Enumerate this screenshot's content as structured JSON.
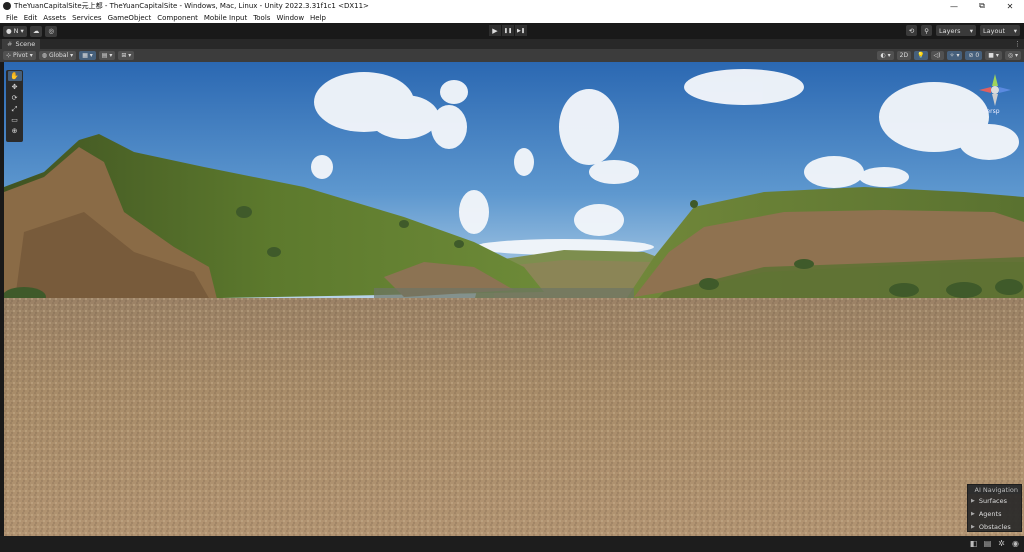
{
  "window": {
    "title": "TheYuanCapitalSite元上都 - TheYuanCapitalSite - Windows, Mac, Linux - Unity 2022.3.31f1c1 <DX11>",
    "controls": {
      "minimize": "—",
      "maximize": "⧉",
      "close": "✕"
    }
  },
  "menu": {
    "items": [
      "File",
      "Edit",
      "Assets",
      "Services",
      "GameObject",
      "Component",
      "Mobile Input",
      "Tools",
      "Window",
      "Help"
    ]
  },
  "toolbar": {
    "account": "N",
    "play": "▶",
    "pause": "❚❚",
    "step": "▶❚",
    "history_icon": "history-icon",
    "search_icon": "search-icon",
    "layers_label": "Layers",
    "layout_label": "Layout"
  },
  "tabs": {
    "scene_label": "Scene"
  },
  "scenebar": {
    "pivot_label": "Pivot",
    "global_label": "Global",
    "mode_2d": "2D"
  },
  "gizmo": {
    "projection_label": "Persp"
  },
  "ai_navigation": {
    "title": "AI Navigation",
    "items": [
      "Surfaces",
      "Agents",
      "Obstacles"
    ]
  },
  "colors": {
    "editor_bg": "#191919",
    "panel": "#3c3c3c",
    "selected": "#46607c",
    "sky_top": "#2f6fb6",
    "ground": "#a88962",
    "hill_green": "#5e7a2e",
    "rock": "#8a6b46"
  }
}
